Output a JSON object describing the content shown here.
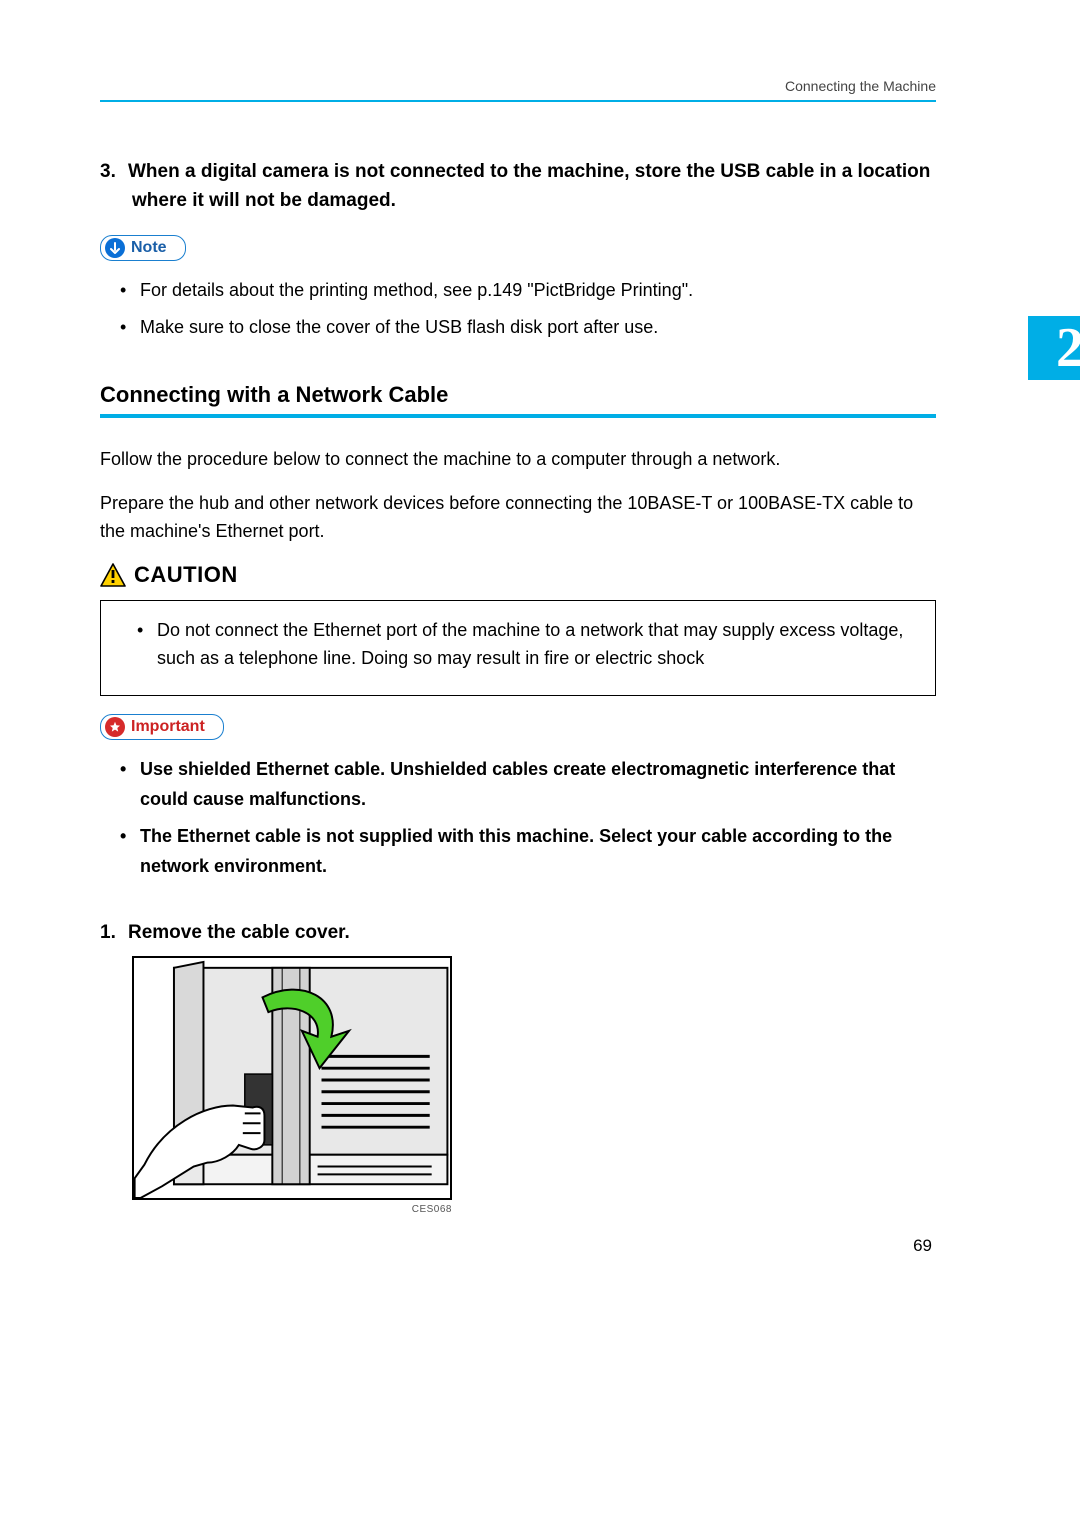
{
  "header": {
    "running_title": "Connecting the Machine"
  },
  "chapter_tab": "2",
  "step3": {
    "number": "3.",
    "text": "When a digital camera is not connected to the machine, store the USB cable in a location where it will not be damaged."
  },
  "note": {
    "label": "Note",
    "items": [
      "For details about the printing method, see p.149 \"PictBridge Printing\".",
      "Make sure to close the cover of the USB flash disk port after use."
    ]
  },
  "section": {
    "heading": "Connecting with a Network Cable",
    "para1": "Follow the procedure below to connect the machine to a computer through a network.",
    "para2": "Prepare the hub and other network devices before connecting the 10BASE-T or 100BASE-TX cable to the machine's Ethernet port."
  },
  "caution": {
    "label": "CAUTION",
    "items": [
      "Do not connect the Ethernet port of the machine to a network that may supply excess voltage, such as a telephone line. Doing so may result in fire or electric shock"
    ]
  },
  "important": {
    "label": "Important",
    "items": [
      "Use shielded Ethernet cable. Unshielded cables create electromagnetic interference that could cause malfunctions.",
      "The Ethernet cable is not supplied with this machine. Select your cable according to the network environment."
    ]
  },
  "step1": {
    "number": "1.",
    "text": "Remove the cable cover."
  },
  "figure": {
    "caption": "CES068"
  },
  "page_number": "69"
}
